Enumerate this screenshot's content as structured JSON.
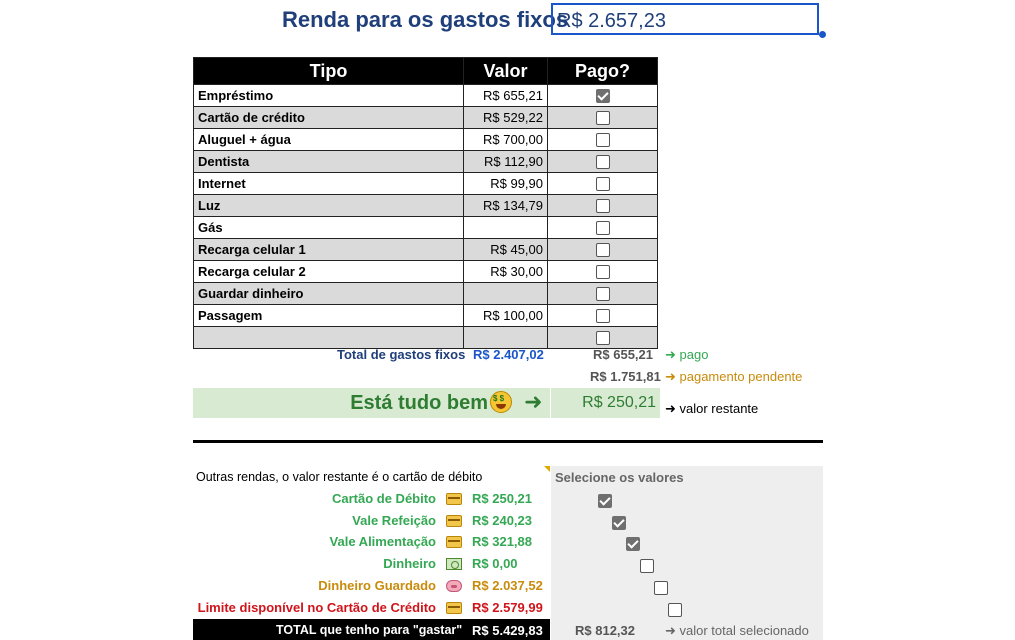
{
  "header": {
    "label": "Renda para os gastos fixos",
    "value": "R$ 2.657,23"
  },
  "table": {
    "headers": [
      "Tipo",
      "Valor",
      "Pago?"
    ],
    "rows": [
      {
        "tipo": "Empréstimo",
        "valor": "R$ 655,21",
        "pago": true
      },
      {
        "tipo": "Cartão de crédito",
        "valor": "R$ 529,22",
        "pago": false
      },
      {
        "tipo": "Aluguel + água",
        "valor": "R$ 700,00",
        "pago": false
      },
      {
        "tipo": "Dentista",
        "valor": "R$ 112,90",
        "pago": false
      },
      {
        "tipo": "Internet",
        "valor": "R$ 99,90",
        "pago": false
      },
      {
        "tipo": "Luz",
        "valor": "R$ 134,79",
        "pago": false
      },
      {
        "tipo": "Gás",
        "valor": "",
        "pago": false
      },
      {
        "tipo": "Recarga celular 1",
        "valor": "R$ 45,00",
        "pago": false
      },
      {
        "tipo": "Recarga celular 2",
        "valor": "R$ 30,00",
        "pago": false
      },
      {
        "tipo": "Guardar dinheiro",
        "valor": "",
        "pago": false
      },
      {
        "tipo": "Passagem",
        "valor": "R$ 100,00",
        "pago": false
      },
      {
        "tipo": "",
        "valor": "",
        "pago": false
      }
    ]
  },
  "totals": {
    "label": "Total de gastos fixos",
    "value": "R$ 2.407,02",
    "pago_value": "R$ 655,21",
    "pago_note": "➜ pago",
    "pendente_value": "R$ 1.751,81",
    "pendente_note": "➜ pagamento pendente"
  },
  "status": {
    "text": "Está tudo bem",
    "arrow": "➜",
    "restante_value": "R$ 250,21",
    "restante_note": "➜ valor restante"
  },
  "lower": {
    "outras_text": "Outras rendas, o valor restante é o cartão de débito",
    "selecione_title": "Selecione os valores",
    "incomes": [
      {
        "label": "Cartão de Débito",
        "icon": "credit-card-icon",
        "value": "R$ 250,21",
        "checked": true,
        "color": "#34a853"
      },
      {
        "label": "Vale Refeição",
        "icon": "credit-card-icon",
        "value": "R$ 240,23",
        "checked": true,
        "color": "#34a853"
      },
      {
        "label": "Vale Alimentação",
        "icon": "credit-card-icon",
        "value": "R$ 321,88",
        "checked": true,
        "color": "#34a853"
      },
      {
        "label": "Dinheiro",
        "icon": "money-icon",
        "value": "R$ 0,00",
        "checked": false,
        "color": "#34a853"
      },
      {
        "label": "Dinheiro Guardado",
        "icon": "piggy-bank-icon",
        "value": "R$ 2.037,52",
        "checked": false,
        "color": "#c98b0b"
      },
      {
        "label": "Limite disponível no Cartão de Crédito",
        "icon": "credit-card-icon",
        "value": "R$ 2.579,99",
        "checked": false,
        "color": "#d0141a"
      }
    ],
    "total_label": "TOTAL que tenho para \"gastar\"",
    "total_value": "R$ 5.429,83",
    "total_selected": "R$ 812,32",
    "total_selected_note": "➜ valor total selecionado"
  }
}
